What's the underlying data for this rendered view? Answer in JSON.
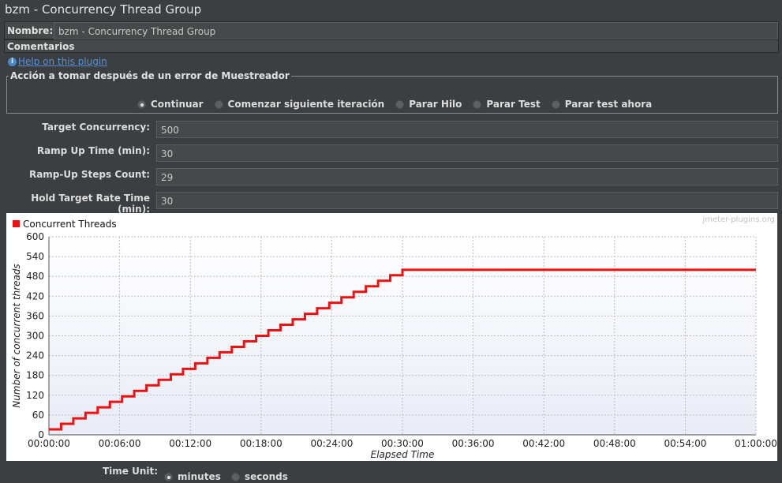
{
  "title": "bzm - Concurrency Thread Group",
  "name_label": "Nombre:",
  "name_value": "bzm - Concurrency Thread Group",
  "comments_label": "Comentarios",
  "help_link": "Help on this plugin",
  "error_action": {
    "legend": "Acción a tomar después de un error de Muestreador",
    "options": [
      "Continuar",
      "Comenzar siguiente iteración",
      "Parar Hilo",
      "Parar Test",
      "Parar test ahora"
    ],
    "selected": "Continuar"
  },
  "params": {
    "target_concurrency_label": "Target Concurrency:",
    "target_concurrency": "500",
    "ramp_up_label": "Ramp Up Time (min):",
    "ramp_up": "30",
    "steps_label": "Ramp-Up Steps Count:",
    "steps": "29",
    "hold_label": "Hold Target Rate Time (min):",
    "hold": "30"
  },
  "chart_watermark": "jmeter-plugins.org",
  "chart_data": {
    "type": "line",
    "legend": "Concurrent Threads",
    "xlabel": "Elapsed Time",
    "ylabel": "Number of concurrent threads",
    "x_ticks": [
      "00:00:00",
      "00:06:00",
      "00:12:00",
      "00:18:00",
      "00:24:00",
      "00:30:00",
      "00:36:00",
      "00:42:00",
      "00:48:00",
      "00:54:00",
      "01:00:00"
    ],
    "y_ticks": [
      0,
      60,
      120,
      180,
      240,
      300,
      360,
      420,
      480,
      540,
      600
    ],
    "xlim_minutes": [
      0,
      60
    ],
    "ylim": [
      0,
      600
    ],
    "target": 500,
    "ramp_up_minutes": 30,
    "steps": 29,
    "hold_minutes": 30,
    "color": "#ee1111"
  },
  "time_unit": {
    "label": "Time Unit:",
    "options": [
      "minutes",
      "seconds"
    ],
    "selected": "minutes"
  }
}
